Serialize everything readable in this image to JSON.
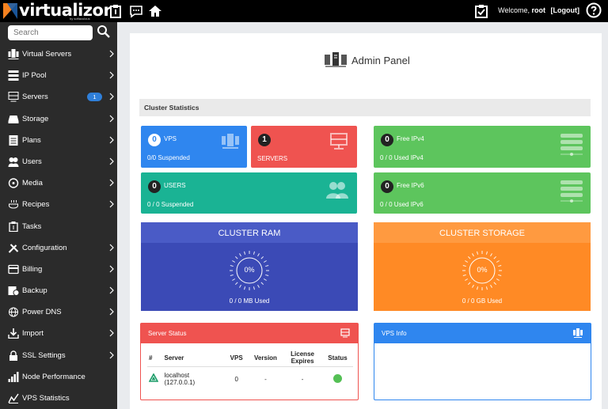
{
  "topbar": {
    "logo_text": "virtualizor",
    "logo_sub": "by softaculous",
    "welcome_prefix": "Welcome,",
    "username": "root",
    "logout": "[Logout]"
  },
  "sidebar": {
    "search_placeholder": "Search",
    "items": [
      {
        "label": "Virtual Servers",
        "icon": "virtual-servers-icon",
        "chevron": true
      },
      {
        "label": "IP Pool",
        "icon": "ip-pool-icon",
        "chevron": true
      },
      {
        "label": "Servers",
        "icon": "servers-icon",
        "chevron": true,
        "badge": "1"
      },
      {
        "label": "Storage",
        "icon": "storage-icon",
        "chevron": true
      },
      {
        "label": "Plans",
        "icon": "plans-icon",
        "chevron": true
      },
      {
        "label": "Users",
        "icon": "users-icon",
        "chevron": true
      },
      {
        "label": "Media",
        "icon": "media-icon",
        "chevron": true
      },
      {
        "label": "Recipes",
        "icon": "recipes-icon",
        "chevron": true
      },
      {
        "label": "Tasks",
        "icon": "tasks-icon",
        "chevron": false
      },
      {
        "label": "Configuration",
        "icon": "configuration-icon",
        "chevron": true
      },
      {
        "label": "Billing",
        "icon": "billing-icon",
        "chevron": true
      },
      {
        "label": "Backup",
        "icon": "backup-icon",
        "chevron": true
      },
      {
        "label": "Power DNS",
        "icon": "power-dns-icon",
        "chevron": true
      },
      {
        "label": "Import",
        "icon": "import-icon",
        "chevron": true
      },
      {
        "label": "SSL Settings",
        "icon": "ssl-settings-icon",
        "chevron": true
      },
      {
        "label": "Node Performance",
        "icon": "node-performance-icon",
        "chevron": false
      },
      {
        "label": "VPS Statistics",
        "icon": "vps-statistics-icon",
        "chevron": false
      }
    ]
  },
  "main": {
    "title": "Admin Panel",
    "cluster_stats_label": "Cluster Statistics",
    "cards": {
      "vps": {
        "count": "0",
        "title": "VPS",
        "sub": "0/0 Suspended"
      },
      "servers": {
        "count": "1",
        "title": "SERVERS"
      },
      "users": {
        "count": "0",
        "title": "USERS",
        "sub": "0 / 0 Suspended"
      },
      "ipv4": {
        "count": "0",
        "title": "Free IPv4",
        "sub": "0 / 0 Used IPv4"
      },
      "ipv6": {
        "count": "0",
        "title": "Free IPv6",
        "sub": "0 / 0 Used IPv6"
      }
    },
    "ram": {
      "title": "CLUSTER RAM",
      "percent": "0%",
      "used": "0 / 0 MB Used"
    },
    "storage": {
      "title": "CLUSTER STORAGE",
      "percent": "0%",
      "used": "0 / 0 GB Used"
    },
    "server_status": {
      "title": "Server Status",
      "headers": {
        "hash": "#",
        "server": "Server",
        "vps": "VPS",
        "version": "Version",
        "license": "License Expires",
        "status": "Status"
      },
      "rows": [
        {
          "server_name": "localhost",
          "server_ip": "(127.0.0.1)",
          "vps": "0",
          "version": "-",
          "license": "-",
          "status": "online"
        }
      ]
    },
    "vps_info": {
      "title": "VPS Info"
    }
  },
  "colors": {
    "blue": "#2f86ef",
    "red": "#ef5350",
    "teal": "#1ab394",
    "green": "#5dc55d",
    "indigo": "#3b4ab6",
    "orange": "#ff8a25",
    "sidebar": "#2b2b2b"
  }
}
